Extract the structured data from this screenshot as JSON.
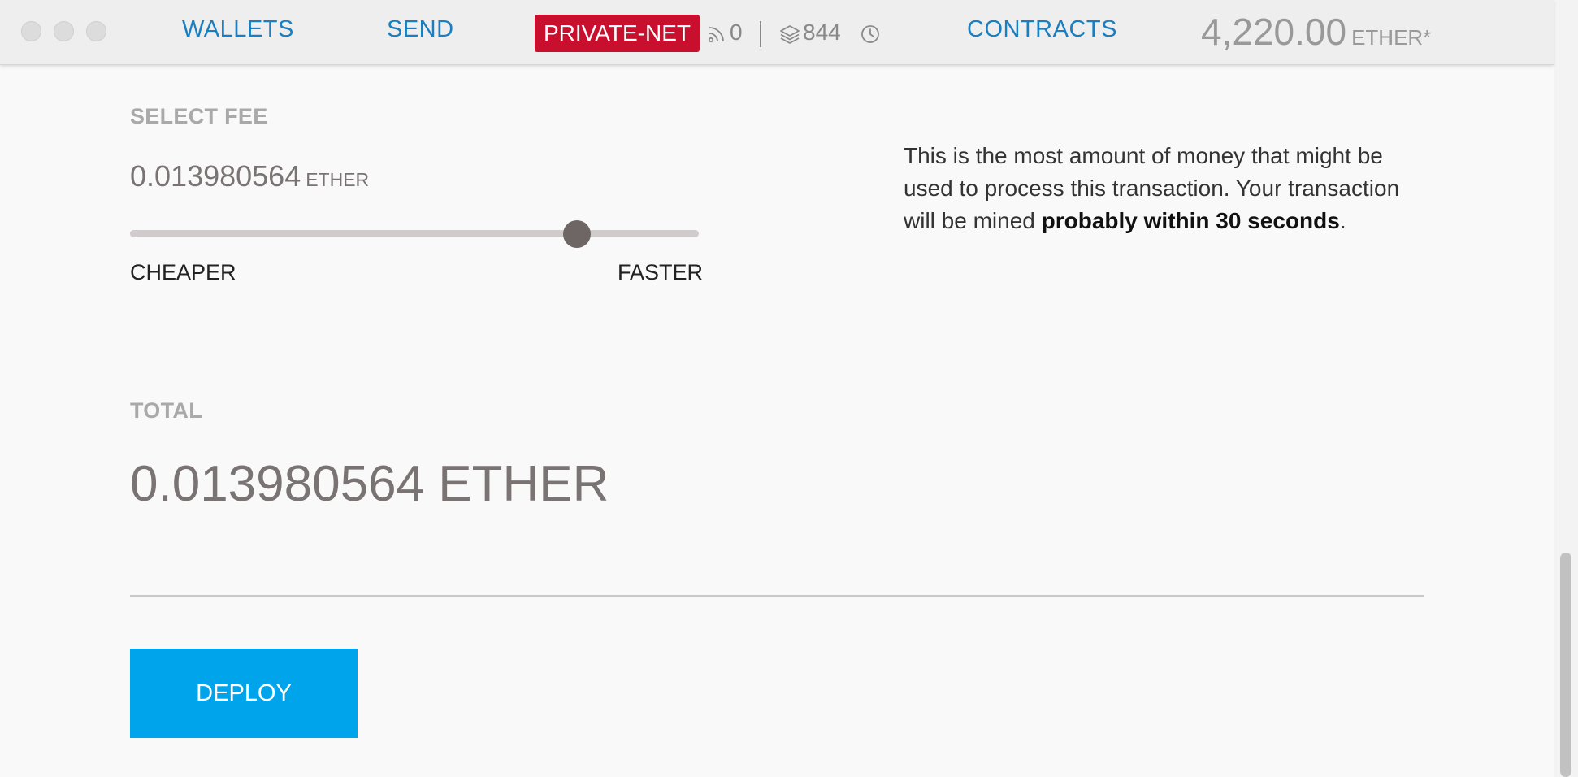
{
  "header": {
    "nav": {
      "wallets": "WALLETS",
      "send": "SEND",
      "contracts": "CONTRACTS"
    },
    "network_badge": "PRIVATE-NET",
    "peer_count": "0",
    "block_count": "844",
    "balance": {
      "amount": "4,220.00",
      "unit": "ETHER*"
    },
    "icons": [
      "peers-signal-icon",
      "layers-icon",
      "clock-icon"
    ]
  },
  "fee": {
    "label": "SELECT FEE",
    "value": "0.013980564",
    "unit": "ETHER",
    "slider": {
      "level": 0.785,
      "left_label": "CHEAPER",
      "right_label": "FASTER"
    },
    "info_text_1": "This is the most amount of money that might be used to process this transaction. Your transaction will be mined ",
    "info_text_bold": "probably within 30 seconds",
    "info_text_2": "."
  },
  "total": {
    "label": "TOTAL",
    "value": "0.013980564 ETHER"
  },
  "deploy_label": "DEPLOY",
  "colors": {
    "link": "#1a7fc0",
    "network_badge": "#c8102e",
    "deploy_button": "#00a4ea",
    "slider_thumb": "#6e6565"
  }
}
